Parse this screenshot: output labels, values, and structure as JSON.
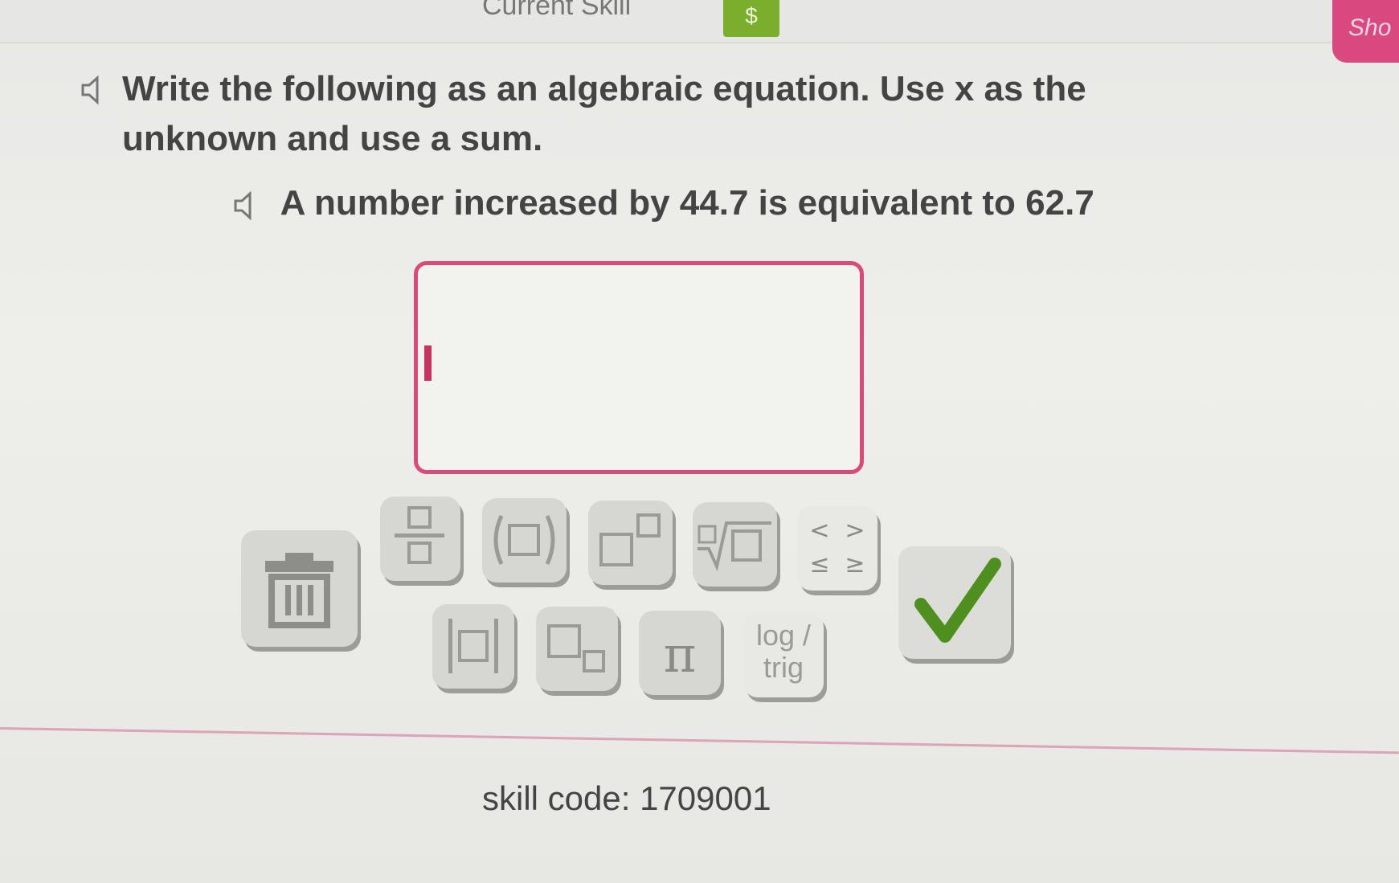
{
  "header": {
    "skill_label": "Current Skill",
    "skill_badge": "$",
    "show_tab": "Sho"
  },
  "question": {
    "instruction": "Write the following as an algebraic equation. Use x as the unknown and use a sum.",
    "problem": "A number increased by 44.7 is equivalent to 62.7"
  },
  "answer": {
    "value": ""
  },
  "keypad": {
    "trash_icon": "trash-icon",
    "fraction_icon": "fraction-icon",
    "parentheses_icon": "parentheses-icon",
    "exponent_icon": "exponent-icon",
    "root_icon": "nth-root-icon",
    "inequalities": [
      "<",
      ">",
      "≤",
      "≥"
    ],
    "absolute_value_icon": "absolute-value-icon",
    "subscript_icon": "subscript-icon",
    "pi_label": "π",
    "log_trig_label_line1": "log /",
    "log_trig_label_line2": "trig",
    "submit_icon": "checkmark-icon"
  },
  "footer": {
    "skill_code": "skill code: 1709001"
  },
  "colors": {
    "accent_pink": "#d94a7b",
    "check_green": "#4f8f1f",
    "badge_green": "#7cae2e"
  }
}
